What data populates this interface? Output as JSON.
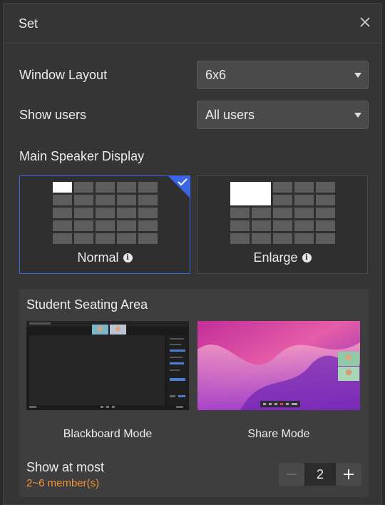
{
  "dialog": {
    "title": "Set"
  },
  "window_layout": {
    "label": "Window Layout",
    "value": "6x6"
  },
  "show_users": {
    "label": "Show users",
    "value": "All users"
  },
  "main_speaker": {
    "title": "Main Speaker Display",
    "options": [
      {
        "label": "Normal",
        "selected": true
      },
      {
        "label": "Enlarge",
        "selected": false
      }
    ]
  },
  "seating": {
    "title": "Student Seating Area",
    "modes": [
      {
        "label": "Blackboard Mode"
      },
      {
        "label": "Share Mode"
      }
    ],
    "show_at_most": {
      "label": "Show at most",
      "range": "2~6 member(s)",
      "value": "2"
    }
  },
  "colors": {
    "accent": "#3a66e6",
    "range_text": "#f0943a"
  }
}
